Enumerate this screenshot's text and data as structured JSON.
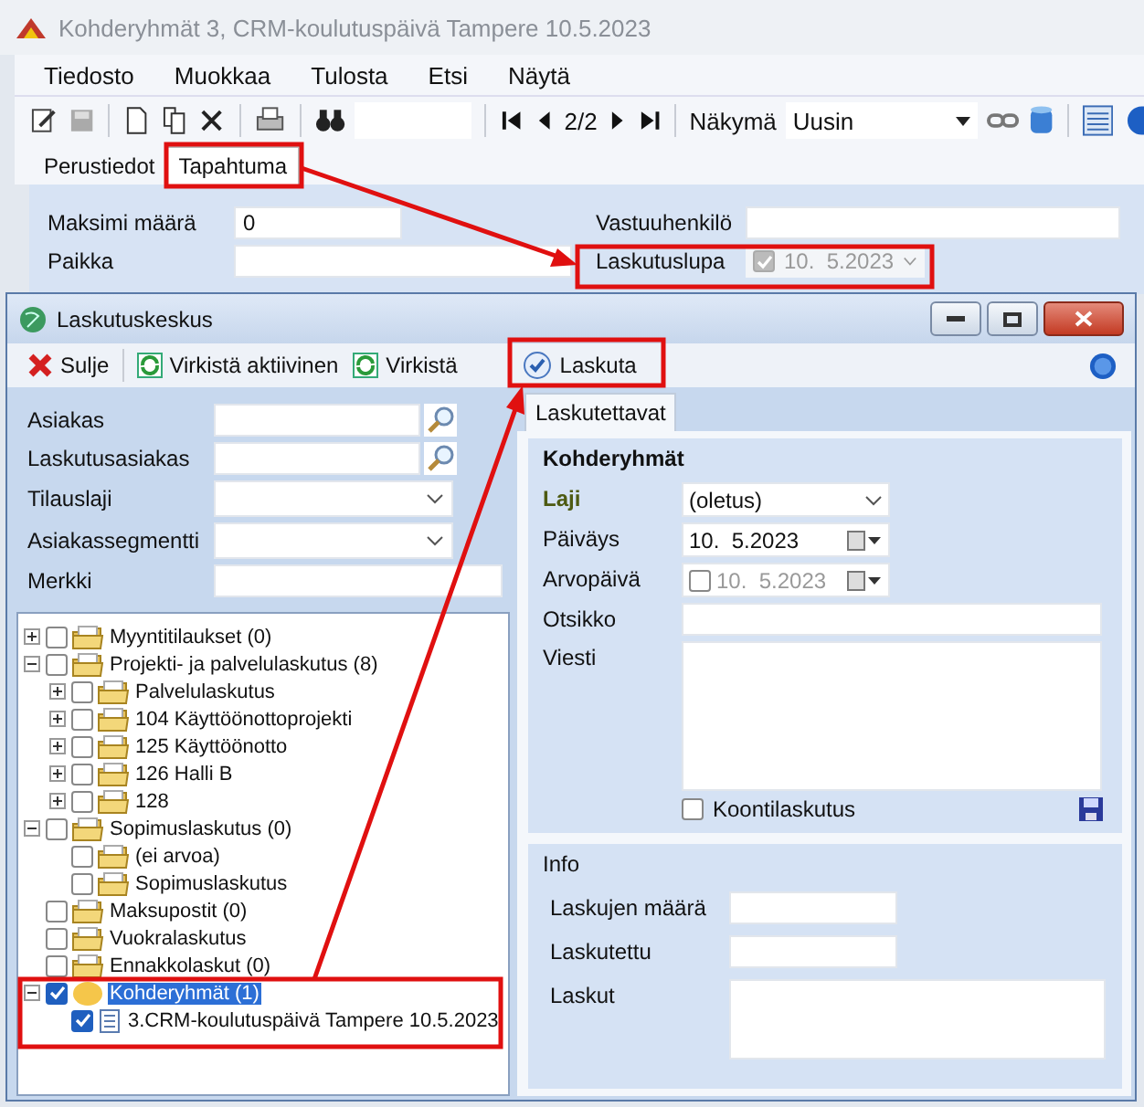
{
  "main_window": {
    "title": "Kohderyhmät 3, CRM-koulutuspäivä Tampere 10.5.2023",
    "menu": [
      "Tiedosto",
      "Muokkaa",
      "Tulosta",
      "Etsi",
      "Näytä"
    ],
    "toolbar": {
      "record": "2/2",
      "view_label": "Näkymä",
      "view": "Uusin"
    },
    "tabs": [
      {
        "label": "Perustiedot",
        "selected": false
      },
      {
        "label": "Tapahtuma",
        "selected": true
      }
    ],
    "fields": [
      {
        "label": "Maksimi määrä",
        "kind": "number",
        "value": "0"
      },
      {
        "label": "Vastuuhenkilö",
        "kind": "text"
      },
      {
        "label": "Paikka",
        "kind": "text"
      },
      {
        "label": "Laskutuslupa",
        "kind": "date",
        "checked": true,
        "disabled": true,
        "value": "10.  5.2023"
      }
    ]
  },
  "dialog": {
    "title": "Laskutuskeskus",
    "toolbar": [
      {
        "label": "Sulje",
        "kind": "close"
      },
      {
        "label": "Virkistä aktiivinen",
        "kind": "refresh"
      },
      {
        "label": "Virkistä",
        "kind": "refresh"
      },
      {
        "label": "Laskuta",
        "kind": "invoice"
      }
    ],
    "filters": [
      {
        "label": "Asiakas",
        "kind": "lookup"
      },
      {
        "label": "Laskutusasiakas",
        "kind": "lookup"
      },
      {
        "label": "Tilauslaji",
        "kind": "dropdown"
      },
      {
        "label": "Asiakassegmentti",
        "kind": "dropdown"
      },
      {
        "label": "Merkki",
        "kind": "text"
      }
    ],
    "tree": [
      {
        "label": "Myyntitilaukset (0)",
        "kind": "folder",
        "checked": false,
        "selected": false,
        "expanded": false
      },
      {
        "label": "Projekti- ja palvelulaskutus (8)",
        "kind": "folder",
        "checked": false,
        "selected": false,
        "expanded": true,
        "children": [
          {
            "label": "Palvelulaskutus",
            "kind": "folder",
            "checked": false,
            "selected": false,
            "expanded": false
          },
          {
            "label": "104 Käyttöönottoprojekti",
            "kind": "folder",
            "checked": false,
            "selected": false,
            "expanded": false
          },
          {
            "label": "125 Käyttöönotto",
            "kind": "folder",
            "checked": false,
            "selected": false,
            "expanded": false
          },
          {
            "label": "126 Halli B",
            "kind": "folder",
            "checked": false,
            "selected": false,
            "expanded": false
          },
          {
            "label": "128",
            "kind": "folder",
            "checked": false,
            "selected": false,
            "expanded": false
          }
        ]
      },
      {
        "label": "Sopimuslaskutus (0)",
        "kind": "folder",
        "checked": false,
        "selected": false,
        "expanded": true,
        "children": [
          {
            "label": "(ei arvoa)",
            "kind": "folder",
            "checked": false,
            "selected": false
          },
          {
            "label": "Sopimuslaskutus",
            "kind": "folder",
            "checked": false,
            "selected": false
          }
        ]
      },
      {
        "label": "Maksupostit (0)",
        "kind": "folder",
        "checked": false,
        "selected": false
      },
      {
        "label": "Vuokralaskutus",
        "kind": "folder",
        "checked": false,
        "selected": false
      },
      {
        "label": "Ennakkolaskut (0)",
        "kind": "folder",
        "checked": false,
        "selected": false
      },
      {
        "label": "Kohderyhmät (1)",
        "kind": "group",
        "checked": true,
        "selected": true,
        "expanded": true,
        "children": [
          {
            "label": "3.CRM-koulutuspäivä Tampere 10.5.2023",
            "kind": "document",
            "checked": true,
            "selected": false
          }
        ]
      }
    ],
    "tabs": [
      {
        "label": "Laskutettavat",
        "selected": true
      }
    ],
    "group": {
      "title": "Kohderyhmät",
      "fields": [
        {
          "label": "Laji",
          "kind": "dropdown",
          "value": "(oletus)",
          "required": true
        },
        {
          "label": "Päiväys",
          "kind": "date",
          "value": "10.  5.2023",
          "required": false
        },
        {
          "label": "Arvopäivä",
          "kind": "optional_date",
          "checked": false,
          "disabled": true,
          "value": "10.  5.2023",
          "required": false
        },
        {
          "label": "Otsikko",
          "kind": "wide",
          "required": false
        },
        {
          "label": "Viesti",
          "kind": "memo",
          "required": false
        }
      ],
      "option": {
        "label": "Koontilaskutus",
        "checked": false
      }
    },
    "info": {
      "title": "Info",
      "fields": [
        {
          "label": "Laskujen määrä",
          "kind": "text"
        },
        {
          "label": "Laskutettu",
          "kind": "text"
        },
        {
          "label": "Laskut",
          "kind": "memo"
        }
      ]
    }
  }
}
